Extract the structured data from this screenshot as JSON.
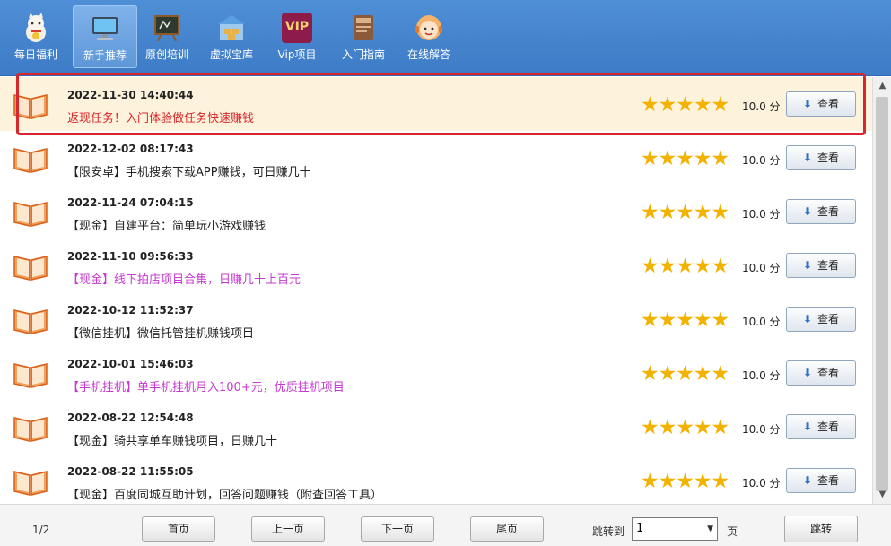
{
  "toolbar": {
    "items": [
      {
        "label": "每日福利"
      },
      {
        "label": "新手推荐"
      },
      {
        "label": "原创培训"
      },
      {
        "label": "虚拟宝库"
      },
      {
        "label": "Vip项目",
        "icon_text": "VIP"
      },
      {
        "label": "入门指南"
      },
      {
        "label": "在线解答"
      }
    ]
  },
  "list": {
    "rows": [
      {
        "date": "2022-11-30 14:40:44",
        "title": "返现任务！入门体验做任务快速赚钱",
        "title_color": "#d8262a",
        "stars": "★★★★★",
        "score": "10.0 分",
        "view_label": "查看",
        "highlight": true
      },
      {
        "date": "2022-12-02 08:17:43",
        "title": "【限安卓】手机搜索下载APP赚钱，可日赚几十",
        "title_color": "#222222",
        "stars": "★★★★★",
        "score": "10.0 分",
        "view_label": "查看"
      },
      {
        "date": "2022-11-24 07:04:15",
        "title": "【现金】自建平台：简单玩小游戏赚钱",
        "title_color": "#222222",
        "stars": "★★★★★",
        "score": "10.0 分",
        "view_label": "查看"
      },
      {
        "date": "2022-11-10 09:56:33",
        "title": "【现金】线下拍店项目合集，日赚几十上百元",
        "title_color": "#c53ad0",
        "stars": "★★★★★",
        "score": "10.0 分",
        "view_label": "查看"
      },
      {
        "date": "2022-10-12 11:52:37",
        "title": "【微信挂机】微信托管挂机赚钱项目",
        "title_color": "#222222",
        "stars": "★★★★★",
        "score": "10.0 分",
        "view_label": "查看"
      },
      {
        "date": "2022-10-01 15:46:03",
        "title": "【手机挂机】单手机挂机月入100+元，优质挂机项目",
        "title_color": "#c53ad0",
        "stars": "★★★★★",
        "score": "10.0 分",
        "view_label": "查看"
      },
      {
        "date": "2022-08-22 12:54:48",
        "title": "【现金】骑共享单车赚钱项目，日赚几十",
        "title_color": "#222222",
        "stars": "★★★★★",
        "score": "10.0 分",
        "view_label": "查看"
      },
      {
        "date": "2022-08-22 11:55:05",
        "title": "【现金】百度同城互助计划，回答问题赚钱（附查回答工具）",
        "title_color": "#222222",
        "stars": "★★★★★",
        "score": "10.0 分",
        "view_label": "查看"
      }
    ]
  },
  "pagination": {
    "page_info": "1/2",
    "first_label": "首页",
    "prev_label": "上一页",
    "next_label": "下一页",
    "last_label": "尾页",
    "jump_to_label": "跳转到",
    "jump_value": "1",
    "page_unit": "页",
    "jump_button_label": "跳转"
  },
  "colors": {
    "toolbar_bg": "#4a8ad3",
    "highlight_border": "#d9262c",
    "star": "#f2b300",
    "book": "#e8742a"
  }
}
